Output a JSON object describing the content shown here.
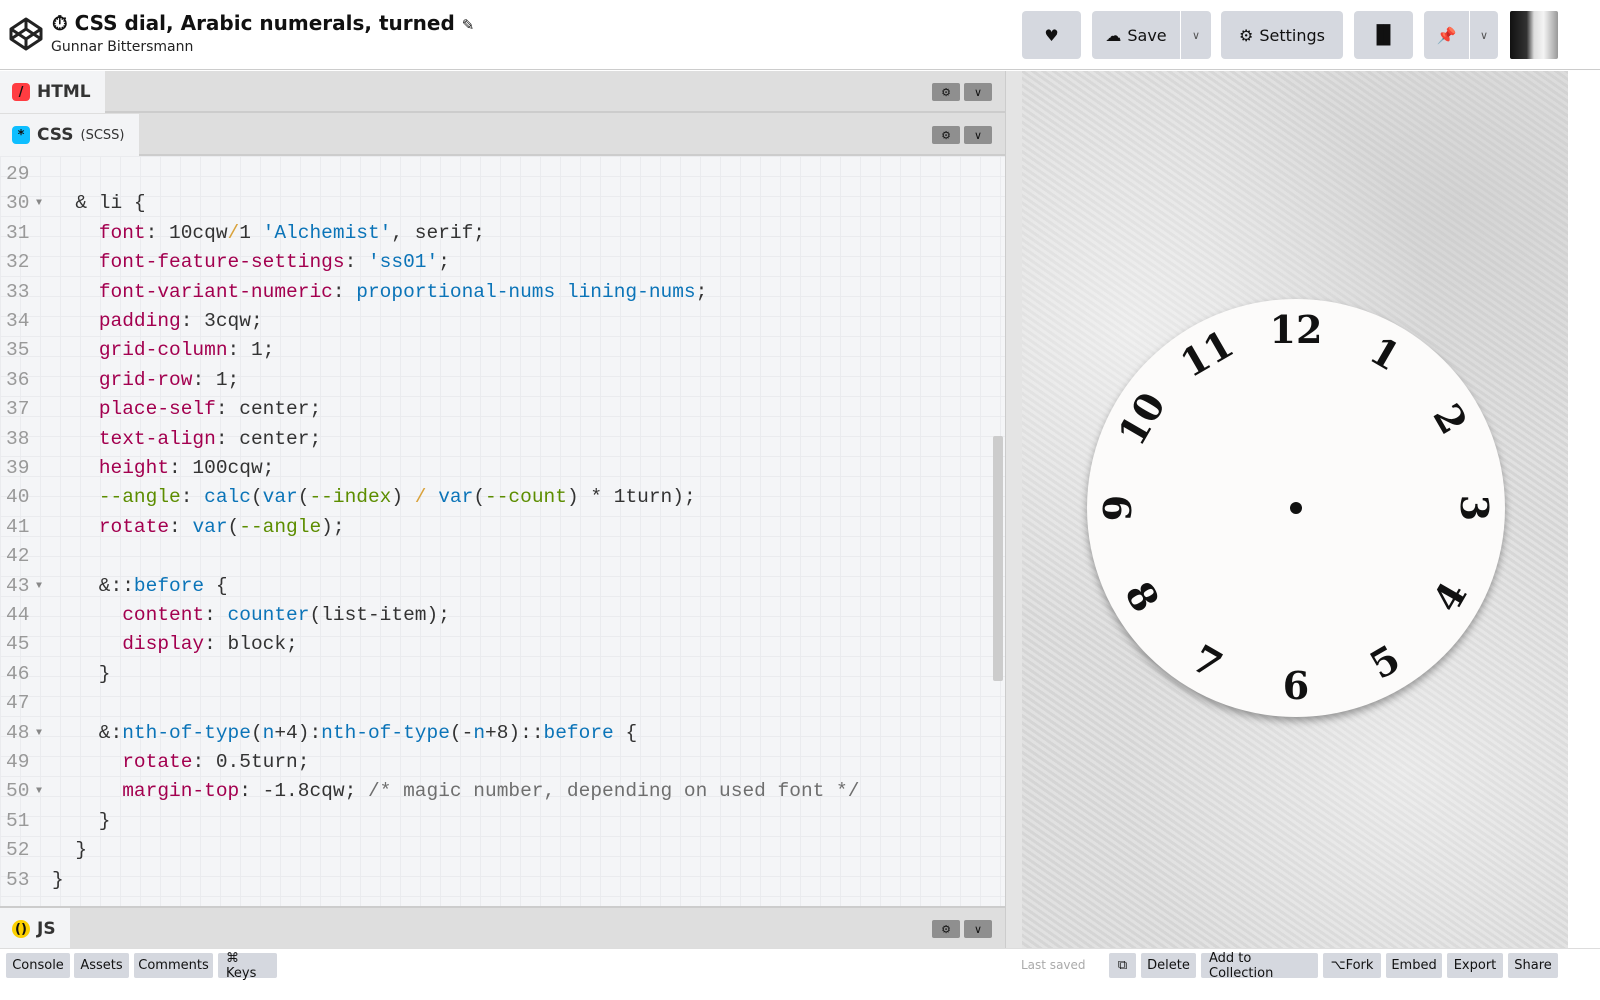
{
  "header": {
    "title": "CSS dial, Arabic numerals, turned",
    "title_icon": "stopwatch-icon",
    "author": "Gunnar Bittersmann",
    "buttons": {
      "like": "heart-icon",
      "save": "Save",
      "settings": "Settings",
      "layout": "layout-icon",
      "pin": "pin-icon"
    }
  },
  "panes": {
    "html": {
      "label": "HTML",
      "color": "#ff3c41"
    },
    "css": {
      "label": "CSS",
      "sub": "(SCSS)",
      "color": "#0ebeff"
    },
    "js": {
      "label": "JS",
      "color": "#fcd000"
    }
  },
  "code": [
    {
      "n": "29",
      "t": []
    },
    {
      "n": "30",
      "f": true,
      "t": [
        [
          "",
          "  & li {"
        ]
      ]
    },
    {
      "n": "31",
      "t": [
        [
          "",
          "    "
        ],
        [
          "prop",
          "font"
        ],
        [
          "",
          ": 10cqw"
        ],
        [
          "op",
          "/"
        ],
        [
          "",
          "1 "
        ],
        [
          "str",
          "'Alchemist'"
        ],
        [
          "",
          ", serif;"
        ]
      ]
    },
    {
      "n": "32",
      "t": [
        [
          "",
          "    "
        ],
        [
          "prop",
          "font-feature-settings"
        ],
        [
          "",
          ": "
        ],
        [
          "str",
          "'ss01'"
        ],
        [
          "",
          ";"
        ]
      ]
    },
    {
      "n": "33",
      "t": [
        [
          "",
          "    "
        ],
        [
          "prop",
          "font-variant-numeric"
        ],
        [
          "",
          ": "
        ],
        [
          "fn",
          "proportional-nums lining-nums"
        ],
        [
          "",
          ";"
        ]
      ]
    },
    {
      "n": "34",
      "t": [
        [
          "",
          "    "
        ],
        [
          "prop",
          "padding"
        ],
        [
          "",
          ": 3cqw;"
        ]
      ]
    },
    {
      "n": "35",
      "t": [
        [
          "",
          "    "
        ],
        [
          "prop",
          "grid-column"
        ],
        [
          "",
          ": 1;"
        ]
      ]
    },
    {
      "n": "36",
      "t": [
        [
          "",
          "    "
        ],
        [
          "prop",
          "grid-row"
        ],
        [
          "",
          ": 1;"
        ]
      ]
    },
    {
      "n": "37",
      "t": [
        [
          "",
          "    "
        ],
        [
          "prop",
          "place-self"
        ],
        [
          "",
          ": center;"
        ]
      ]
    },
    {
      "n": "38",
      "t": [
        [
          "",
          "    "
        ],
        [
          "prop",
          "text-align"
        ],
        [
          "",
          ": center;"
        ]
      ]
    },
    {
      "n": "39",
      "t": [
        [
          "",
          "    "
        ],
        [
          "prop",
          "height"
        ],
        [
          "",
          ": 100cqw;"
        ]
      ]
    },
    {
      "n": "40",
      "t": [
        [
          "",
          "    "
        ],
        [
          "var",
          "--angle"
        ],
        [
          "",
          ": "
        ],
        [
          "fn",
          "calc"
        ],
        [
          "",
          "("
        ],
        [
          "fn",
          "var"
        ],
        [
          "",
          "("
        ],
        [
          "var",
          "--index"
        ],
        [
          "",
          ") "
        ],
        [
          "op",
          "/"
        ],
        [
          "fn",
          " var"
        ],
        [
          "",
          "("
        ],
        [
          "var",
          "--count"
        ],
        [
          "",
          ") * 1turn);"
        ]
      ]
    },
    {
      "n": "41",
      "t": [
        [
          "",
          "    "
        ],
        [
          "prop",
          "rotate"
        ],
        [
          "",
          ": "
        ],
        [
          "fn",
          "var"
        ],
        [
          "",
          "("
        ],
        [
          "var",
          "--angle"
        ],
        [
          "",
          ");"
        ]
      ]
    },
    {
      "n": "42",
      "t": []
    },
    {
      "n": "43",
      "f": true,
      "t": [
        [
          "",
          "    &::"
        ],
        [
          "fn",
          "before"
        ],
        [
          "",
          " {"
        ]
      ]
    },
    {
      "n": "44",
      "t": [
        [
          "",
          "      "
        ],
        [
          "prop",
          "content"
        ],
        [
          "",
          ": "
        ],
        [
          "fn",
          "counter"
        ],
        [
          "",
          "(list-item);"
        ]
      ]
    },
    {
      "n": "45",
      "t": [
        [
          "",
          "      "
        ],
        [
          "prop",
          "display"
        ],
        [
          "",
          ": block;"
        ]
      ]
    },
    {
      "n": "46",
      "t": [
        [
          "",
          "    }"
        ]
      ]
    },
    {
      "n": "47",
      "t": []
    },
    {
      "n": "48",
      "f": true,
      "t": [
        [
          "",
          "    &:"
        ],
        [
          "fn",
          "nth-of-type"
        ],
        [
          "",
          "("
        ],
        [
          "fn",
          "n"
        ],
        [
          "",
          "+4):"
        ],
        [
          "fn",
          "nth-of-type"
        ],
        [
          "",
          "(-"
        ],
        [
          "fn",
          "n"
        ],
        [
          "",
          "+8)::"
        ],
        [
          "fn",
          "before"
        ],
        [
          "",
          " {"
        ]
      ]
    },
    {
      "n": "49",
      "t": [
        [
          "",
          "      "
        ],
        [
          "prop",
          "rotate"
        ],
        [
          "",
          ": 0.5turn;"
        ]
      ]
    },
    {
      "n": "50",
      "f": true,
      "t": [
        [
          "",
          "      "
        ],
        [
          "prop",
          "margin-top"
        ],
        [
          "",
          ": -1.8cqw; "
        ],
        [
          "cm",
          "/* magic number, depending on used font */"
        ]
      ]
    },
    {
      "n": "51",
      "t": [
        [
          "",
          "    }"
        ]
      ]
    },
    {
      "n": "52",
      "t": [
        [
          "",
          "  }"
        ]
      ]
    },
    {
      "n": "53",
      "t": [
        [
          "",
          "}"
        ]
      ]
    }
  ],
  "dial": {
    "numerals": [
      "12",
      "1",
      "2",
      "3",
      "4",
      "5",
      "6",
      "7",
      "8",
      "9",
      "10",
      "11"
    ],
    "flipped": [
      "4",
      "5",
      "6",
      "7",
      "8"
    ]
  },
  "footer": {
    "left": [
      "Console",
      "Assets",
      "Comments",
      "⌘ Keys"
    ],
    "last_saved": "Last saved",
    "right": [
      "Delete",
      "Add to Collection",
      "Fork",
      "Embed",
      "Export",
      "Share"
    ]
  }
}
